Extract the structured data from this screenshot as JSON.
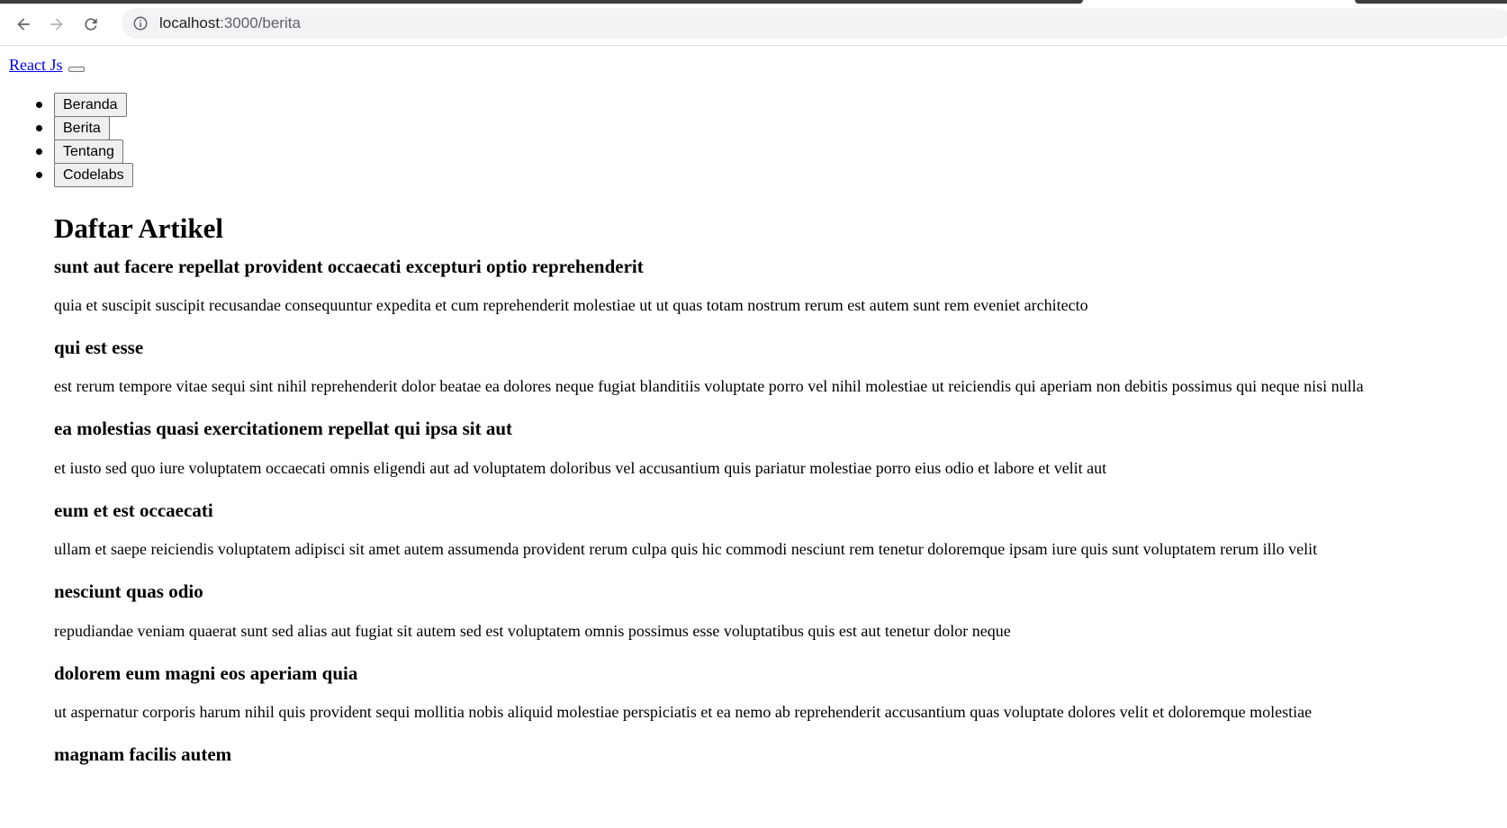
{
  "browser": {
    "url_host": "localhost",
    "url_path": ":3000/berita"
  },
  "navbar": {
    "brand": "React Js",
    "menu": [
      "Beranda",
      "Berita",
      "Tentang",
      "Codelabs"
    ]
  },
  "page": {
    "title": "Daftar Artikel",
    "articles": [
      {
        "title": "sunt aut facere repellat provident occaecati excepturi optio reprehenderit",
        "body": "quia et suscipit suscipit recusandae consequuntur expedita et cum reprehenderit molestiae ut ut quas totam nostrum rerum est autem sunt rem eveniet architecto"
      },
      {
        "title": "qui est esse",
        "body": "est rerum tempore vitae sequi sint nihil reprehenderit dolor beatae ea dolores neque fugiat blanditiis voluptate porro vel nihil molestiae ut reiciendis qui aperiam non debitis possimus qui neque nisi nulla"
      },
      {
        "title": "ea molestias quasi exercitationem repellat qui ipsa sit aut",
        "body": "et iusto sed quo iure voluptatem occaecati omnis eligendi aut ad voluptatem doloribus vel accusantium quis pariatur molestiae porro eius odio et labore et velit aut"
      },
      {
        "title": "eum et est occaecati",
        "body": "ullam et saepe reiciendis voluptatem adipisci sit amet autem assumenda provident rerum culpa quis hic commodi nesciunt rem tenetur doloremque ipsam iure quis sunt voluptatem rerum illo velit"
      },
      {
        "title": "nesciunt quas odio",
        "body": "repudiandae veniam quaerat sunt sed alias aut fugiat sit autem sed est voluptatem omnis possimus esse voluptatibus quis est aut tenetur dolor neque"
      },
      {
        "title": "dolorem eum magni eos aperiam quia",
        "body": "ut aspernatur corporis harum nihil quis provident sequi mollitia nobis aliquid molestiae perspiciatis et ea nemo ab reprehenderit accusantium quas voluptate dolores velit et doloremque molestiae"
      },
      {
        "title": "magnam facilis autem",
        "body": ""
      }
    ]
  },
  "icons": {
    "back": "back-arrow-icon",
    "forward": "forward-arrow-icon",
    "reload": "reload-icon",
    "info": "info-icon"
  },
  "colors": {
    "link": "#0000ee",
    "omnibox_bg": "#f1f3f4"
  }
}
